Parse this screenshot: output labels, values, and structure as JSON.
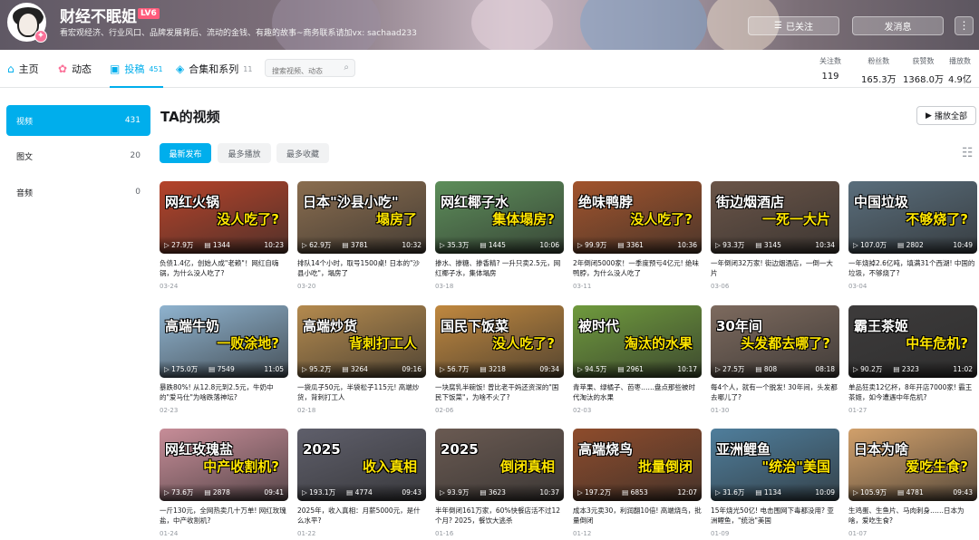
{
  "header": {
    "username": "财经不眠姐",
    "level": "LV6",
    "signature": "看宏观经济、行业风口、品牌发展背后、流动的金钱、有趣的故事~商务联系请加vx: sachaad233",
    "follow_label": "已关注",
    "message_label": "发消息",
    "more_label": "⋮"
  },
  "nav": {
    "tabs": [
      {
        "label": "主页",
        "icon": "home-icon",
        "count": ""
      },
      {
        "label": "动态",
        "icon": "dynamic-icon",
        "count": ""
      },
      {
        "label": "投稿",
        "icon": "upload-icon",
        "count": "451"
      },
      {
        "label": "合集和系列",
        "icon": "collection-icon",
        "count": "11"
      }
    ],
    "search_placeholder": "搜索视频、动态"
  },
  "stats": [
    {
      "label": "关注数",
      "value": "119"
    },
    {
      "label": "粉丝数",
      "value": "165.3万"
    },
    {
      "label": "获赞数",
      "value": "1368.0万"
    },
    {
      "label": "播放数",
      "value": "4.9亿"
    }
  ],
  "sidebar": [
    {
      "label": "视频",
      "count": "431"
    },
    {
      "label": "图文",
      "count": "20"
    },
    {
      "label": "音频",
      "count": "0"
    }
  ],
  "main": {
    "heading": "TA的视频",
    "play_all": "播放全部",
    "filters": [
      "最新发布",
      "最多播放",
      "最多收藏"
    ]
  },
  "videos": [
    {
      "o1": "网红火锅",
      "o2": "没人吃了?",
      "plays": "27.9万",
      "danmaku": "1344",
      "duration": "10:23",
      "title": "负债1.4亿，创始人成\"老赖\"！网红自嗨锅，为什么没人吃了?",
      "date": "03-24",
      "bg": "#b5432a"
    },
    {
      "o1": "日本\"沙县小吃\"",
      "o2": "塌房了",
      "plays": "62.9万",
      "danmaku": "3781",
      "duration": "10:32",
      "title": "排队14个小时，取号1500桌! 日本的\"沙县小吃\"，塌房了",
      "date": "03-20",
      "bg": "#8a6d4f"
    },
    {
      "o1": "网红椰子水",
      "o2": "集体塌房?",
      "plays": "35.3万",
      "danmaku": "1445",
      "duration": "10:06",
      "title": "掺水、掺糖、掺香精? 一升只卖2.5元，网红椰子水，集体塌房",
      "date": "03-18",
      "bg": "#5d8e5a"
    },
    {
      "o1": "绝味鸭脖",
      "o2": "没人吃了?",
      "plays": "99.9万",
      "danmaku": "3361",
      "duration": "10:36",
      "title": "2年倒闭5000家！一季度预亏4亿元! 绝味鸭脖，为什么没人吃了",
      "date": "03-11",
      "bg": "#a2542c"
    },
    {
      "o1": "街边烟酒店",
      "o2": "一死一大片",
      "plays": "93.3万",
      "danmaku": "3145",
      "duration": "10:34",
      "title": "一年倒闭32万家! 街边烟酒店，一倒一大片",
      "date": "03-06",
      "bg": "#6b5548"
    },
    {
      "o1": "中国垃圾",
      "o2": "不够烧了?",
      "plays": "107.0万",
      "danmaku": "2802",
      "duration": "10:49",
      "title": "一年烧掉2.6亿吨，填满31个西湖! 中国的垃圾，不够烧了?",
      "date": "03-04",
      "bg": "#5a6e7c"
    },
    {
      "o1": "高端牛奶",
      "o2": "一败涂地?",
      "plays": "175.0万",
      "danmaku": "7549",
      "duration": "11:05",
      "title": "暴跌80%! 从12.8元到2.5元，牛奶中的\"爱马仕\"为啥跌落神坛?",
      "date": "02-23",
      "bg": "#8fb3cf"
    },
    {
      "o1": "高端炒货",
      "o2": "背刺打工人",
      "plays": "95.2万",
      "danmaku": "3264",
      "duration": "09:16",
      "title": "一袋瓜子50元，半袋松子115元! 高端炒货，背刺打工人",
      "date": "02-18",
      "bg": "#b48a4e"
    },
    {
      "o1": "国民下饭菜",
      "o2": "没人吃了?",
      "plays": "56.7万",
      "danmaku": "3218",
      "duration": "09:34",
      "title": "一块腐乳半碗饭! 曾比老干妈还资深的\"国民下饭菜\"，为啥不火了?",
      "date": "02-06",
      "bg": "#c0883f"
    },
    {
      "o1": "被时代",
      "o2": "淘汰的水果",
      "plays": "94.5万",
      "danmaku": "2961",
      "duration": "10:17",
      "title": "青苹果、绿橘子、芭枣……盘点那些被时代淘汰的水果",
      "date": "02-03",
      "bg": "#6f9a3d"
    },
    {
      "o1": "30年间",
      "o2": "头发都去哪了?",
      "plays": "27.5万",
      "danmaku": "808",
      "duration": "08:18",
      "title": "每4个人，就有一个脱发! 30年间，头发都去哪儿了?",
      "date": "01-30",
      "bg": "#7d6a5e"
    },
    {
      "o1": "霸王茶姬",
      "o2": "中年危机?",
      "plays": "90.2万",
      "danmaku": "2323",
      "duration": "11:02",
      "title": "单品狂卖12亿杯，8年开店7000家! 霸王茶姬，如今遭遇中年危机?",
      "date": "01-27",
      "bg": "#3d3b3b"
    },
    {
      "o1": "网红玫瑰盐",
      "o2": "中产收割机?",
      "plays": "73.6万",
      "danmaku": "2878",
      "duration": "09:41",
      "title": "一斤130元，全网热卖几十万单! 网红玫瑰盐，中产收割机?",
      "date": "01-24",
      "bg": "#c78d98"
    },
    {
      "o1": "2025",
      "o2": "收入真相",
      "plays": "193.1万",
      "danmaku": "4774",
      "duration": "09:43",
      "title": "2025年，收入真相：月薪5000元，是什么水平?",
      "date": "01-22",
      "bg": "#5f5f6b"
    },
    {
      "o1": "2025",
      "o2": "倒闭真相",
      "plays": "93.9万",
      "danmaku": "3623",
      "duration": "10:37",
      "title": "半年倒闭161万家，60%快餐店活不过12个月? 2025，餐饮大逃杀",
      "date": "01-16",
      "bg": "#6a5a52"
    },
    {
      "o1": "高端烧鸟",
      "o2": "批量倒闭",
      "plays": "197.2万",
      "danmaku": "6853",
      "duration": "12:07",
      "title": "成本3元卖30，利润翻10倍! 高端烧鸟，批量倒闭",
      "date": "01-12",
      "bg": "#8e4c2c"
    },
    {
      "o1": "亚洲鲤鱼",
      "o2": "\"统治\"美国",
      "plays": "31.6万",
      "danmaku": "1134",
      "duration": "10:09",
      "title": "15年烧光50亿! 电击围网下毒都没用? 亚洲鲤鱼，\"统治\"美国",
      "date": "01-09",
      "bg": "#4f7e9c"
    },
    {
      "o1": "日本为啥",
      "o2": "爱吃生食?",
      "plays": "105.9万",
      "danmaku": "4781",
      "duration": "09:43",
      "title": "生鸡蛋、生鱼片、马肉刺身……日本为啥，爱吃生食?",
      "date": "01-07",
      "bg": "#d1a06b"
    }
  ]
}
